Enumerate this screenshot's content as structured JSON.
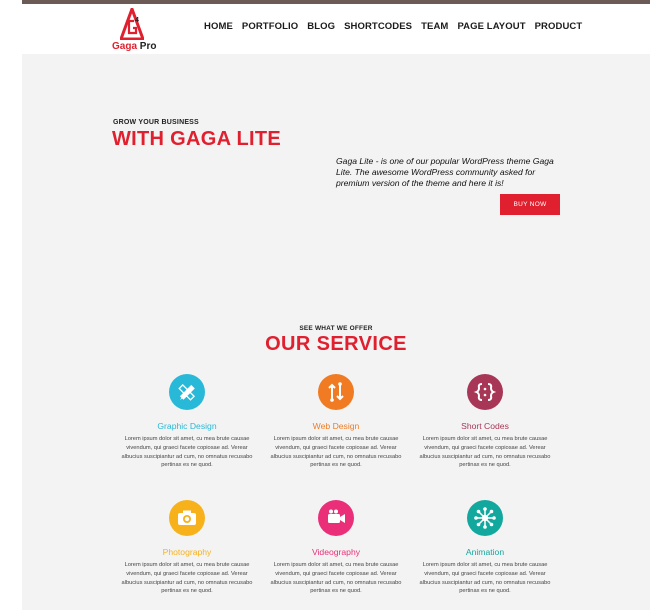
{
  "brand": {
    "name": "Gaga",
    "suffix": "Pro",
    "accent": "#e0202f"
  },
  "nav": {
    "items": [
      "HOME",
      "PORTFOLIO",
      "BLOG",
      "SHORTCODES",
      "TEAM",
      "PAGE LAYOUT",
      "PRODUCT"
    ]
  },
  "hero": {
    "kicker": "GROW YOUR BUSINESS",
    "title": "WITH GAGA LITE",
    "description": "Gaga Lite - is one of our popular WordPress theme Gaga Lite. The awesome WordPress community asked for premium version of the theme and here it is!",
    "button_label": "BUY NOW"
  },
  "services": {
    "kicker": "SEE WHAT WE OFFER",
    "title": "OUR SERVICE",
    "items": [
      {
        "title": "Graphic Design",
        "color": "#28b9d8",
        "icon": "pencil-ruler-icon",
        "text": "Lorem ipsum dolor sit amet, cu mea brute causae vivendum, qui graeci facete copiosae ad. Verear albucius suscipiantur ad cum, no omnatus recusabo pertinax es ne quod."
      },
      {
        "title": "Web Design",
        "color": "#f07b22",
        "icon": "swap-arrows-icon",
        "text": "Lorem ipsum dolor sit amet, cu mea brute causae vivendum, qui graeci facete copiosae ad. Verear albucius suscipiantur ad cum, no omnatus recusabo pertinax es ne quod."
      },
      {
        "title": "Short Codes",
        "color": "#a83757",
        "icon": "code-braces-icon",
        "text": "Lorem ipsum dolor sit amet, cu mea brute causae vivendum, qui graeci facete copiosae ad. Verear albucius suscipiantur ad cum, no omnatus recusabo pertinax es ne quod."
      },
      {
        "title": "Photography",
        "color": "#f7b21b",
        "icon": "camera-icon",
        "text": "Lorem ipsum dolor sit amet, cu mea brute causae vivendum, qui graeci facete copiosae ad. Verear albucius suscipiantur ad cum, no omnatus recusabo pertinax es ne quod."
      },
      {
        "title": "Videography",
        "color": "#ea2f78",
        "icon": "video-camera-icon",
        "text": "Lorem ipsum dolor sit amet, cu mea brute causae vivendum, qui graeci facete copiosae ad. Verear albucius suscipiantur ad cum, no omnatus recusabo pertinax es ne quod."
      },
      {
        "title": "Animation",
        "color": "#13a89e",
        "icon": "network-icon",
        "text": "Lorem ipsum dolor sit amet, cu mea brute causae vivendum, qui graeci facete copiosae ad. Verear albucius suscipiantur ad cum, no omnatus recusabo pertinax es ne quod."
      }
    ]
  }
}
